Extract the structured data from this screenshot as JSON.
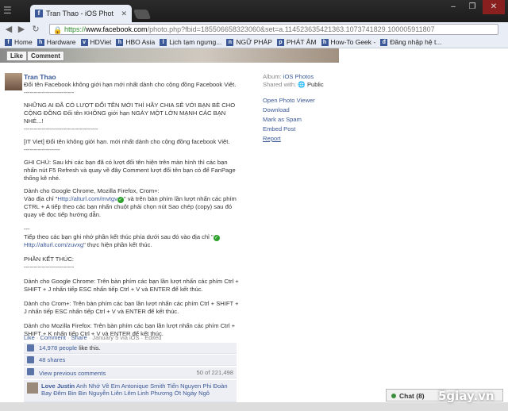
{
  "browser": {
    "tab_title": "Tran Thao - iOS Phot",
    "tab_favicon": "f",
    "url_https": "https://",
    "url_host": "www.facebook.com",
    "url_rest": "/photo.php?fbid=185506658323060&set=a.114523635421363.1073741829.100005911807"
  },
  "bookmarks": [
    {
      "label": "Home",
      "icon": "f"
    },
    {
      "label": "Hardware",
      "icon": "h"
    },
    {
      "label": "HDViet",
      "icon": "v"
    },
    {
      "label": "HBO Asia",
      "icon": "h"
    },
    {
      "label": "Lịch tạm ngưng...",
      "icon": "l"
    },
    {
      "label": "NGỮ PHÁP",
      "icon": "n"
    },
    {
      "label": "PHÁT ÂM",
      "icon": "p"
    },
    {
      "label": "How-To Geek -",
      "icon": "h"
    },
    {
      "label": "Đăng nhập hệ t...",
      "icon": "đ"
    }
  ],
  "photo_actions": {
    "like": "Like",
    "comment": "Comment"
  },
  "post": {
    "author": "Tran Thao",
    "lines": [
      "Đổi tên Facebook không giới hạn mới nhất dành cho cộng đồng Facebook Việt.",
      "-------------------------",
      "",
      "NHỮNG AI ĐÃ CÓ LƯỢT ĐỔI TÊN MỚI THÌ HÃY CHIA SẺ VỚI BẠN BÈ CHO CỘNG ĐỒNG Đổi tên KHÔNG giới hạn NGÀY MỘT LỚN MẠNH CÁC BẠN NHÉ...!",
      "-------------------------------------",
      "",
      "[IT Viet] Đổi tên không giới hạn. mới nhất dành cho cộng đồng facebook Việt.",
      "------------------",
      "",
      "GHI CHÚ: Sau khi các bạn đã có lượt đổi tên hiện trên màn hình thì các bạn nhấn nút F5 Refresh và quay về đây Comment lượt đổi tên bạn có để FanPage thống kê nhé.",
      "",
      "Dành cho Google Chrome, Mozilla Firefox, Crom+:"
    ],
    "chrome_prefix": "Vào địa chỉ \"",
    "link1": "Http://alturl.com/mvtgv",
    "chrome_suffix": "\" và trên bàn phím lần lượt nhấn các phím CTRL + A tiếp theo các bạn nhấn chuột phải chọn nút Sao chép (copy) sau đó quay về đọc tiếp hướng dẫn.",
    "sep": "---",
    "next_prefix": "Tiếp theo các bạn ghi nhớ phần kết thúc phía dưới sau đó vào địa chỉ \"",
    "link2": "Http://alturl.com/zuvxg",
    "next_suffix": "\" thực hiện phần kết thúc.",
    "end_title": "PHẦN KẾT THÚC:",
    "end_sep": "-------------------------",
    "end_chrome": "Dành cho Google Chrome: Trên bàn phím các bạn lần lượt nhấn các phím Ctrl + SHIFT + J nhấn tiếp ESC nhấn tiếp Ctrl + V và ENTER để kết thúc.",
    "end_crom": "Dành cho Crom+: Trên bàn phím các bạn lần lượt nhấn các phím Ctrl + SHIFT + J nhấn tiếp ESC nhấn tiếp Ctrl + V và ENTER để kết thúc.",
    "end_firefox": "Dành cho Mozilla Firefox: Trên bàn phím các bạn lần lượt nhấn các phím Ctrl + SHIFT + K nhấn tiếp Ctrl + V và ENTER để kết thúc.",
    "meta_like": "Like",
    "meta_comment": "Comment",
    "meta_share": "Share",
    "meta_date": "January 5 via iOS",
    "meta_edited": "Edited",
    "likes_count": "14,978 people",
    "likes_suffix": "like this.",
    "shares": "48 shares",
    "view_prev": "View previous comments",
    "comment_count": "50 of 221,498",
    "comment_author": "Love Justin",
    "comment_text": "Anh Nhớ Về Em Antonique Smith Tiến Nguyen Phi Đoàn Bay Đêm Bin Bin Nguyễn Liên Lêm Linh Phương Ớt Ngáy Ngô"
  },
  "sidebar": {
    "album_label": "Album:",
    "album_value": "iOS Photos",
    "shared_label": "Shared with:",
    "shared_value": "Public",
    "links": [
      "Open Photo Viewer",
      "Download",
      "Mark as Spam",
      "Embed Post",
      "Report"
    ]
  },
  "chat": {
    "label": "Chat (8)"
  },
  "watermark": "5giay.vn"
}
